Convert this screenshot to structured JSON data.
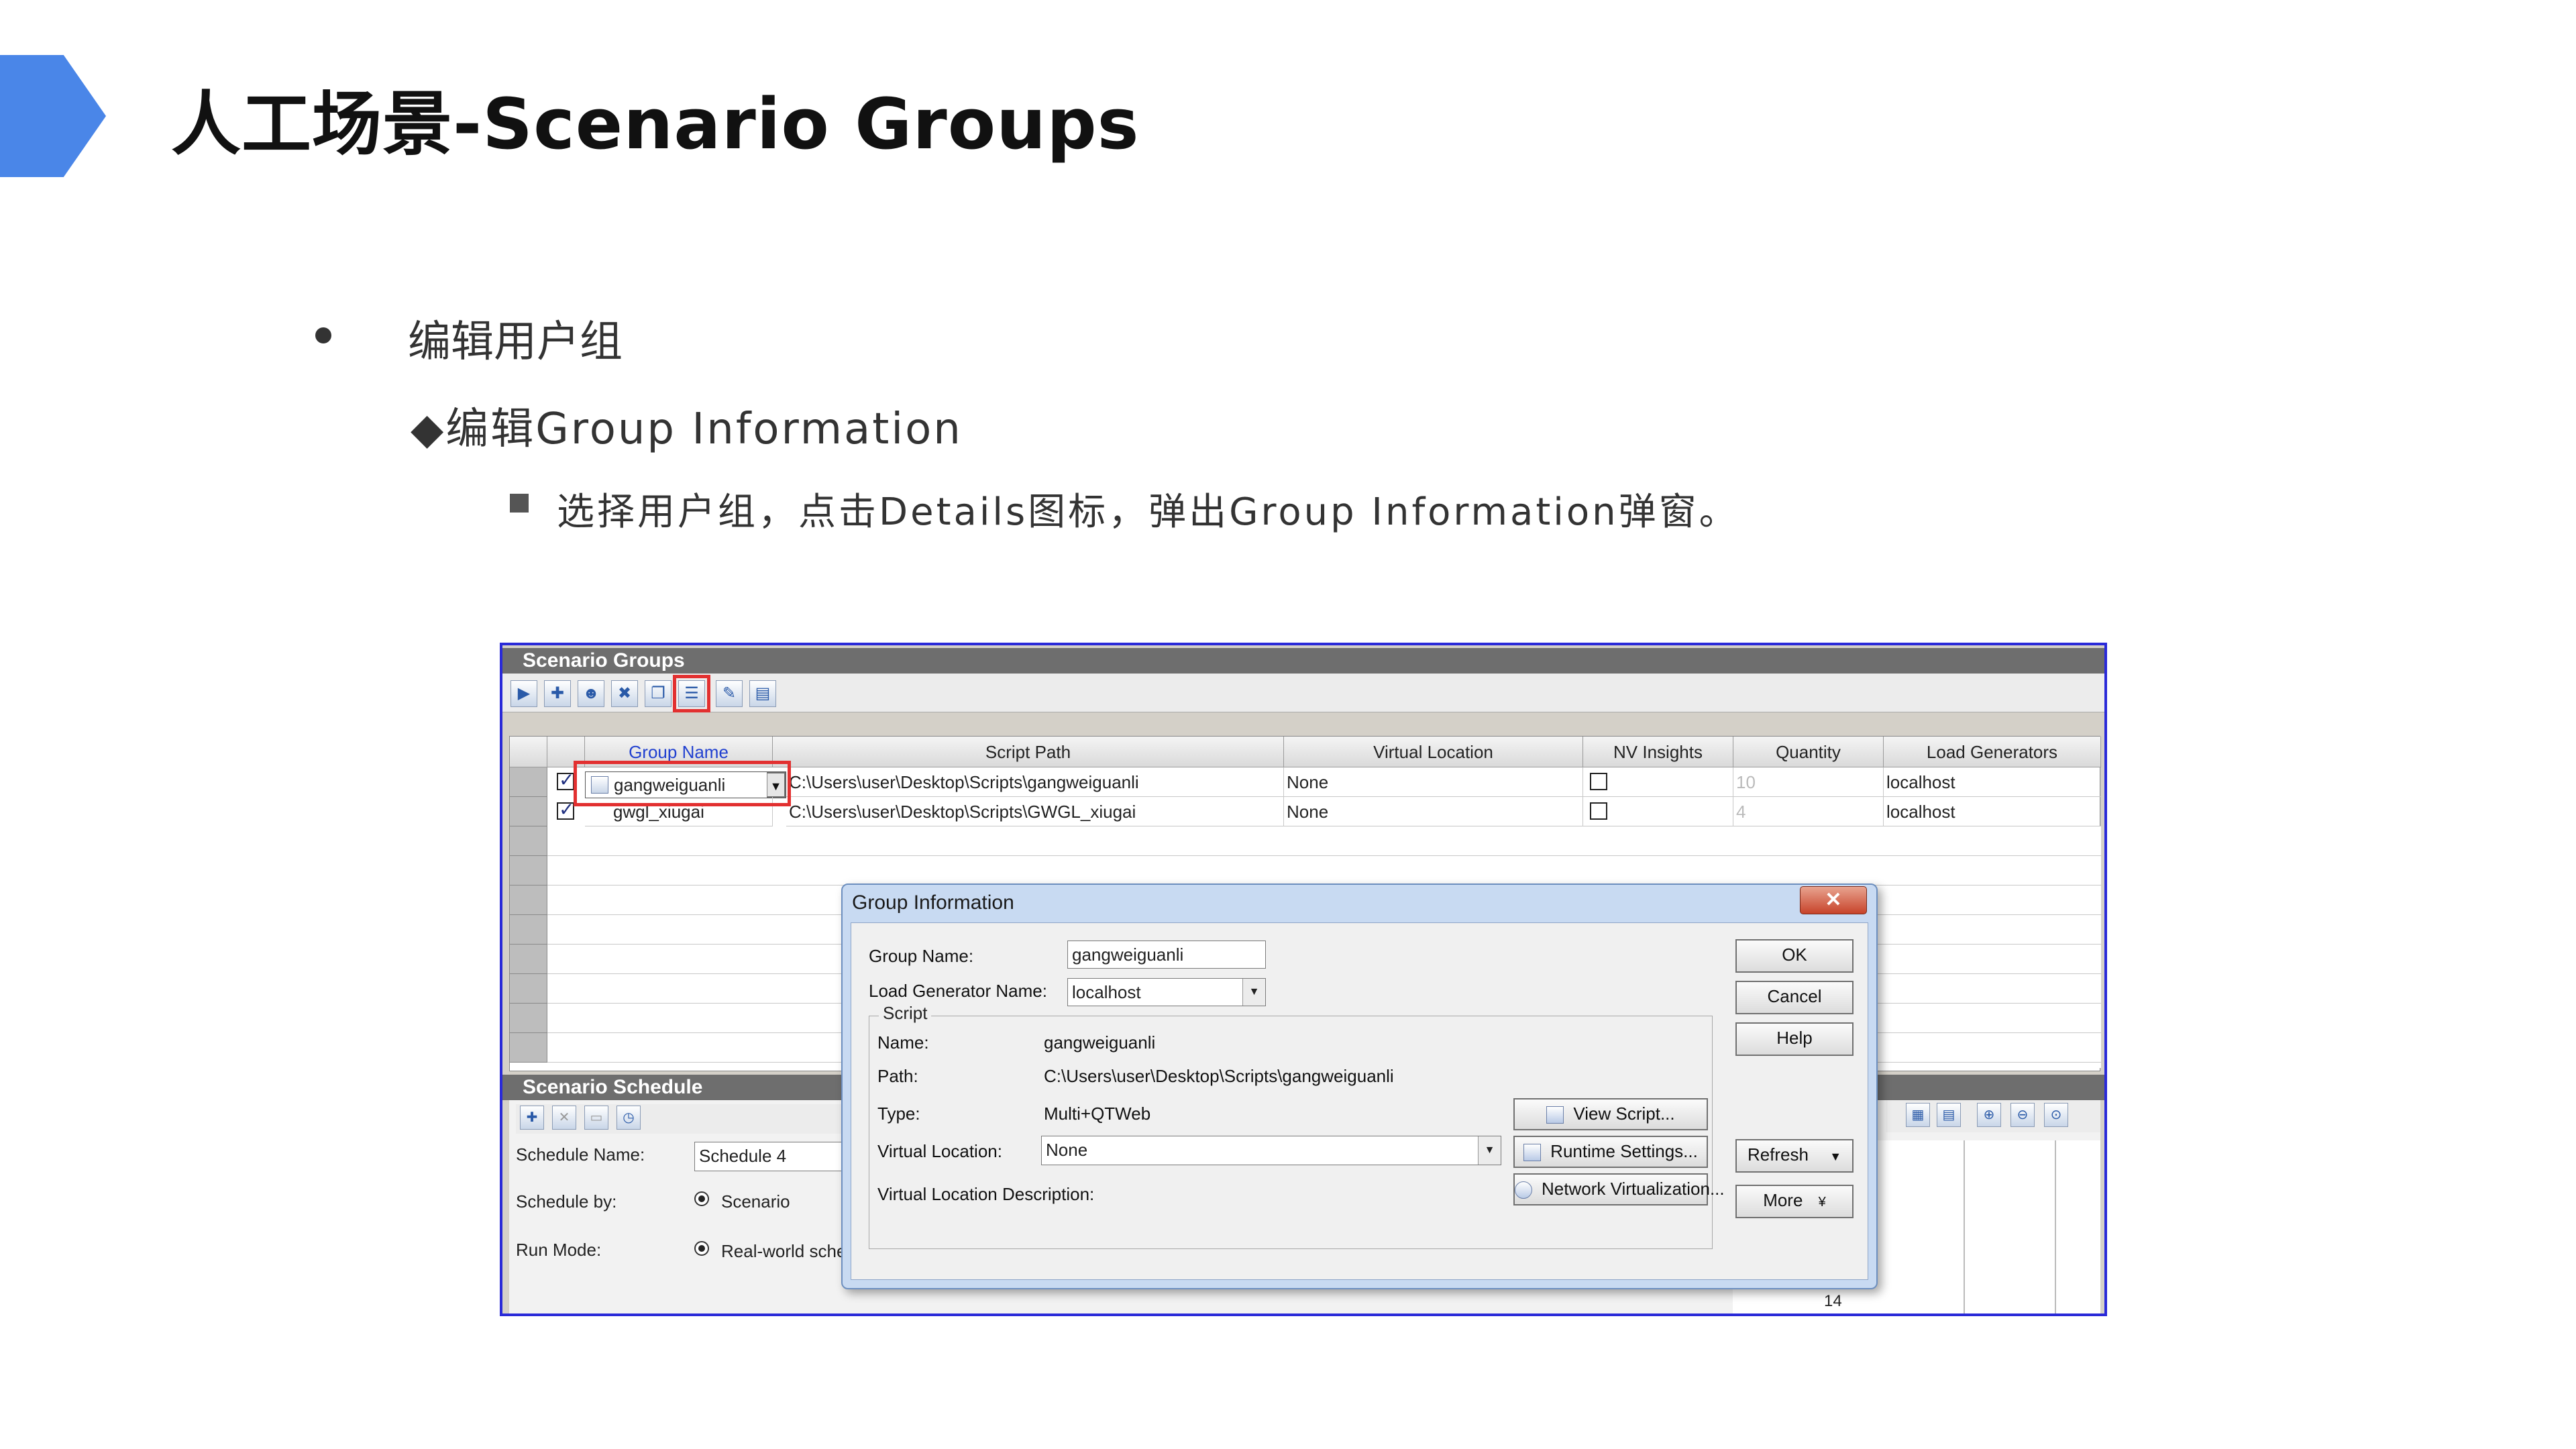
{
  "slide": {
    "title": "人工场景-Scenario Groups",
    "bullet1": "编辑用户组",
    "bullet2": "◆编辑Group Information",
    "bullet3": "选择用户组，点击Details图标，弹出Group Information弹窗。"
  },
  "colors": {
    "accent": "#4a86e8",
    "highlight_red": "#e23030",
    "frame_blue": "#2a2ad8"
  },
  "scenario_groups": {
    "title": "Scenario Groups",
    "toolbar_icons": [
      "play-icon",
      "add-group-icon",
      "add-users-icon",
      "remove-group-icon",
      "copy-icon",
      "details-icon",
      "edit-script-icon",
      "summary-icon"
    ],
    "columns": [
      "Group Name",
      "Script Path",
      "Virtual Location",
      "NV Insights",
      "Quantity",
      "Load Generators"
    ],
    "rows": [
      {
        "checked": true,
        "group_name": "gangweiguanli",
        "script_path": "C:\\Users\\user\\Desktop\\Scripts\\gangweiguanli",
        "virtual_location": "None",
        "nv_insights": false,
        "quantity": "10",
        "load_generators": "localhost"
      },
      {
        "checked": true,
        "group_name": "gwgl_xiugai",
        "script_path": "C:\\Users\\user\\Desktop\\Scripts\\GWGL_xiugai",
        "virtual_location": "None",
        "nv_insights": false,
        "quantity": "4",
        "load_generators": "localhost"
      }
    ]
  },
  "scenario_schedule": {
    "title": "Scenario Schedule",
    "schedule_name_label": "Schedule Name:",
    "schedule_name_value": "Schedule 4",
    "schedule_by_label": "Schedule by:",
    "schedule_by_value": "Scenario",
    "run_mode_label": "Run Mode:",
    "run_mode_value": "Real-world sche",
    "cell_value": "14"
  },
  "dialog": {
    "title": "Group Information",
    "close": "✕",
    "group_name_label": "Group Name:",
    "group_name_value": "gangweiguanli",
    "load_generator_label": "Load Generator Name:",
    "load_generator_value": "localhost",
    "script_legend": "Script",
    "name_label": "Name:",
    "name_value": "gangweiguanli",
    "path_label": "Path:",
    "path_value": "C:\\Users\\user\\Desktop\\Scripts\\gangweiguanli",
    "type_label": "Type:",
    "type_value": "Multi+QTWeb",
    "virtual_location_label": "Virtual Location:",
    "virtual_location_value": "None",
    "vl_description_label": "Virtual Location Description:",
    "buttons": {
      "ok": "OK",
      "cancel": "Cancel",
      "help": "Help",
      "refresh": "Refresh",
      "more": "More",
      "view_script": "View Script...",
      "runtime_settings": "Runtime Settings...",
      "network_virtualization": "Network Virtualization..."
    }
  }
}
